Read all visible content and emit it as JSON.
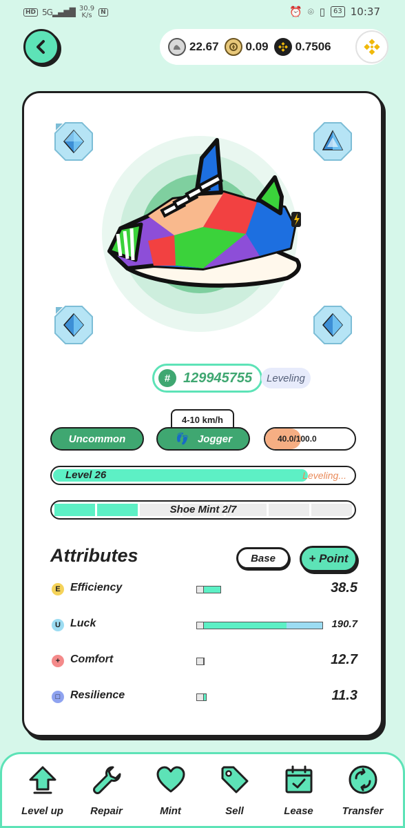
{
  "status_bar": {
    "network": "HD",
    "signal": "5G",
    "speed_value": "30.9",
    "speed_unit": "K/s",
    "nfc": "N",
    "battery": "63",
    "time": "10:37"
  },
  "header": {
    "wallet": [
      {
        "icon": "gst-coin-icon",
        "value": "22.67",
        "color": "#c9c9c9"
      },
      {
        "icon": "gmt-coin-icon",
        "value": "0.09",
        "color": "#e8c87a"
      },
      {
        "icon": "bnb-coin-icon",
        "value": "0.7506",
        "color": "#f0b90b"
      }
    ]
  },
  "sneaker": {
    "id": "129945755",
    "status": "Leveling",
    "speed_range": "4-10 km/h",
    "quality": "Uncommon",
    "type": "Jogger",
    "durability": "40.0/100.0",
    "durability_fraction": 0.4,
    "level_label": "Level 26",
    "level_status": "Leveling...",
    "level_progress": 0.85,
    "mint_label": "Shoe Mint 2/7",
    "mint_count": 2,
    "mint_max": 7
  },
  "attributes": {
    "title": "Attributes",
    "base_label": "Base",
    "point_label": "+ Point",
    "items": [
      {
        "name": "Efficiency",
        "value": "38.5",
        "icon": "E",
        "color": "#f5d35a",
        "add": 24,
        "extra": 0
      },
      {
        "name": "Luck",
        "value": "190.7",
        "icon": "U",
        "color": "#9cdcf2",
        "add": 120,
        "extra": 52
      },
      {
        "name": "Comfort",
        "value": "12.7",
        "icon": "+",
        "color": "#f48a8a",
        "add": 0,
        "extra": 0
      },
      {
        "name": "Resilience",
        "value": "11.3",
        "icon": "□",
        "color": "#8fa3f0",
        "add": 3,
        "extra": 0
      }
    ]
  },
  "nav": [
    {
      "label": "Level up",
      "icon": "level-up-icon"
    },
    {
      "label": "Repair",
      "icon": "wrench-icon"
    },
    {
      "label": "Mint",
      "icon": "heart-icon"
    },
    {
      "label": "Sell",
      "icon": "tag-icon"
    },
    {
      "label": "Lease",
      "icon": "calendar-icon"
    },
    {
      "label": "Transfer",
      "icon": "transfer-icon"
    }
  ]
}
